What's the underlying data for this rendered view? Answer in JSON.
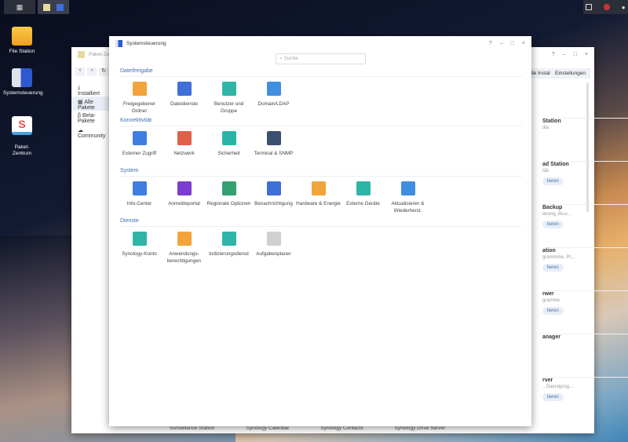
{
  "taskbar": {
    "apps": [
      "main-menu",
      "paket-zentrum",
      "systemsteuerung"
    ],
    "right": [
      "widgets",
      "notifications",
      "user"
    ]
  },
  "desktop": [
    {
      "label": "File Station"
    },
    {
      "label": "Systemsteuerung"
    },
    {
      "label": "Paket-\nZentrum"
    }
  ],
  "paket": {
    "title": "Paket-Zentrum",
    "sidebar": [
      "Installiert",
      "Alle Pakete",
      "Beta-Pakete",
      "Community"
    ],
    "buttons": [
      "Manuelle Installation",
      "Einstellungen"
    ],
    "cards": [
      {
        "name": "Station",
        "desc": "dia",
        "btn": ""
      },
      {
        "name": "ad Station",
        "desc": "ität",
        "btn": "lieren"
      },
      {
        "name": "Backup",
        "desc": "ierung, Busi...",
        "btn": "lieren"
      },
      {
        "name": "ation",
        "desc": "grammme, Pr...",
        "btn": "lieren"
      },
      {
        "name": "rwer",
        "desc": "gramme",
        "btn": "lieren"
      },
      {
        "name": "anager",
        "desc": "",
        "btn": ""
      },
      {
        "name": "rver",
        "desc": "., Dienstprog...",
        "btn": "lieren"
      }
    ],
    "bottom": [
      "Surveillance Station",
      "Synology Calendar",
      "Synology Contacts",
      "Synology Drive Server"
    ]
  },
  "cp": {
    "title": "Systemsteuerung",
    "search_placeholder": "Suche",
    "sections": [
      {
        "title": "Dateifreigabe",
        "items": [
          {
            "label": "Freigegebener Ordner",
            "color": "#f2a43a"
          },
          {
            "label": "Dateidienste",
            "color": "#3f6fd8"
          },
          {
            "label": "Benutzer und Gruppe",
            "color": "#2eb5a8"
          },
          {
            "label": "Domain/LDAP",
            "color": "#3f8ee0"
          }
        ]
      },
      {
        "title": "Konnektivität",
        "items": [
          {
            "label": "Externer Zugriff",
            "color": "#3f7ee0"
          },
          {
            "label": "Netzwerk",
            "color": "#e0604a"
          },
          {
            "label": "Sicherheit",
            "color": "#28b5a8"
          },
          {
            "label": "Terminal & SNMP",
            "color": "#3b4f70"
          }
        ]
      },
      {
        "title": "System",
        "items": [
          {
            "label": "Info-Center",
            "color": "#3f7ee0"
          },
          {
            "label": "Anmeldeportal",
            "color": "#7a3fd0"
          },
          {
            "label": "Regionale Optionen",
            "color": "#35a070"
          },
          {
            "label": "Benachrichtigung",
            "color": "#3f6fd8"
          },
          {
            "label": "Hardware & Energie",
            "color": "#f2a43a"
          },
          {
            "label": "Externe Geräte",
            "color": "#2eb5a8"
          },
          {
            "label": "Aktualisieren & Wiederherst.",
            "color": "#3f8ee0"
          }
        ]
      },
      {
        "title": "Dienste",
        "items": [
          {
            "label": "Synology-Konto",
            "color": "#2eb5a8"
          },
          {
            "label": "Anwendungs-berechtigungen",
            "color": "#f2a43a"
          },
          {
            "label": "Indizierungsdienst",
            "color": "#2eb5a8"
          },
          {
            "label": "Aufgabenplaner",
            "color": "#d0d0d0"
          }
        ]
      }
    ]
  }
}
